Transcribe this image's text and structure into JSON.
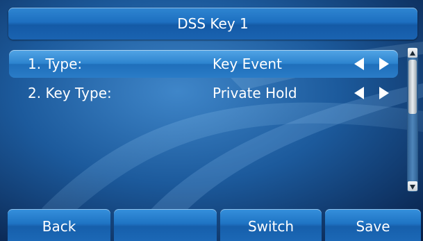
{
  "title": "DSS Key 1",
  "settings": [
    {
      "label": "1. Type:",
      "value": "Key Event",
      "selected": true
    },
    {
      "label": "2. Key Type:",
      "value": "Private Hold",
      "selected": false
    }
  ],
  "icons": {
    "left_arrow": "triangle-left",
    "right_arrow": "triangle-right",
    "scroll_up": "triangle-up",
    "scroll_down": "triangle-down"
  },
  "softkeys": [
    "Back",
    "",
    "Switch",
    "Save"
  ],
  "colors": {
    "accent": "#1f74c4",
    "selected_row": "#2d84cf",
    "text": "#ffffff",
    "background": "#0e2f5c"
  }
}
